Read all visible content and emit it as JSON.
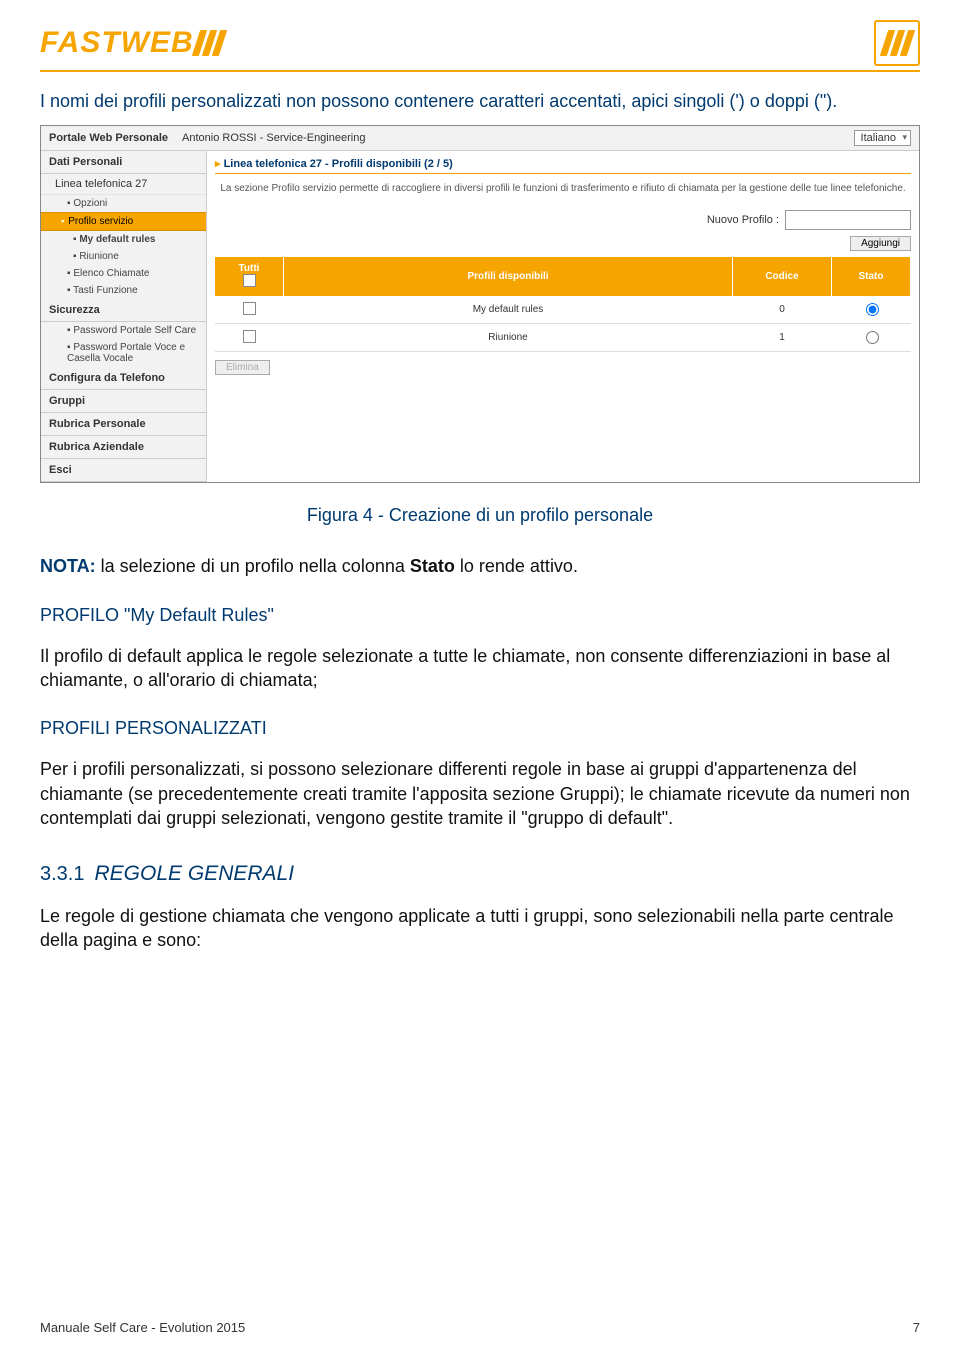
{
  "header": {
    "logo_text": "FASTWEB"
  },
  "intro_text": "I nomi dei profili personalizzati non possono contenere caratteri accentati, apici singoli (') o doppi (\").",
  "screenshot": {
    "portal_label": "Portale Web Personale",
    "user_line": "Antonio ROSSI - Service-Engineering",
    "language": "Italiano",
    "sidebar": {
      "dati_personali": "Dati Personali",
      "linea_telefonica": "Linea telefonica 27",
      "opzioni": "Opzioni",
      "profilo_servizio": "Profilo servizio",
      "my_default_rules": "My default rules",
      "riunione_sub": "Riunione",
      "elenco_chiamate": "Elenco Chiamate",
      "tasti_funzione": "Tasti Funzione",
      "sicurezza": "Sicurezza",
      "pwd_self": "Password Portale Self Care",
      "pwd_voce": "Password Portale Voce e Casella Vocale",
      "configura": "Configura da Telefono",
      "gruppi": "Gruppi",
      "rubrica_pers": "Rubrica Personale",
      "rubrica_az": "Rubrica Aziendale",
      "esci": "Esci"
    },
    "breadcrumb": "Linea telefonica 27 - Profili disponibili (2 / 5)",
    "description": "La sezione Profilo servizio permette di raccogliere in diversi profili le funzioni di trasferimento e rifiuto di chiamata per la gestione delle tue linee telefoniche.",
    "new_profile_label": "Nuovo Profilo :",
    "add_button": "Aggiungi",
    "table": {
      "col_tutti": "Tutti",
      "col_profili": "Profili disponibili",
      "col_codice": "Codice",
      "col_stato": "Stato",
      "rows": [
        {
          "name": "My default rules",
          "code": "0",
          "selected": true
        },
        {
          "name": "Riunione",
          "code": "1",
          "selected": false
        }
      ]
    },
    "elimina": "Elimina"
  },
  "caption": "Figura 4 - Creazione di un profilo personale",
  "nota_label": "NOTA:",
  "nota_text_1": " la selezione di un profilo nella colonna ",
  "nota_bold": "Stato",
  "nota_text_2": " lo rende attivo.",
  "section_default_head": "PROFILO \"My Default Rules\"",
  "section_default_body": "Il profilo di default applica le regole selezionate a tutte le chiamate, non consente differenziazioni in base al chiamante, o all'orario di chiamata;",
  "section_pers_head": "PROFILI PERSONALIZZATI",
  "section_pers_body": "Per i profili personalizzati, si possono selezionare differenti regole in base ai gruppi d'appartenenza del chiamante (se precedentemente creati tramite l'apposita sezione Gruppi); le chiamate ricevute da numeri non contemplati dai gruppi selezionati, vengono gestite tramite il \"gruppo di default\".",
  "subsection_num": "3.3.1",
  "subsection_title": "REGOLE GENERALI",
  "subsection_body": "Le regole di gestione chiamata che vengono applicate a tutti i gruppi, sono selezionabili nella parte centrale della pagina e sono:",
  "footer_left": "Manuale Self Care - Evolution 2015",
  "footer_right": "7"
}
